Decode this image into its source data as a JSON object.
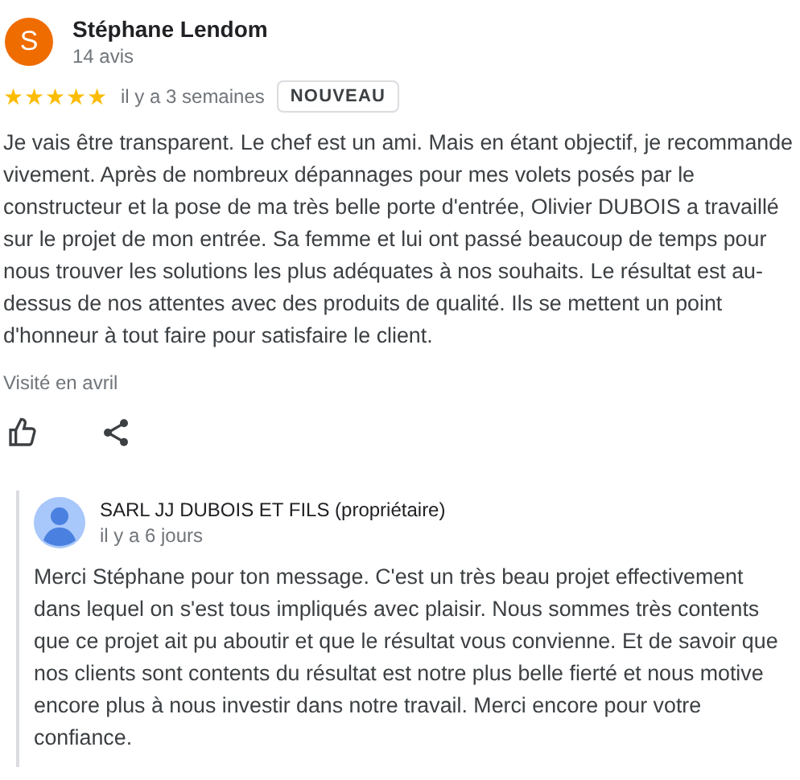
{
  "review": {
    "avatar_letter": "S",
    "author": "Stéphane Lendom",
    "author_meta": "14 avis",
    "stars": 5,
    "time": "il y a 3 semaines",
    "badge": "NOUVEAU",
    "text": "Je vais être transparent. Le chef est un ami. Mais en étant objectif, je recommande vivement. Après de nombreux dépannages pour mes volets posés par le constructeur et la pose de ma très belle porte d'entrée, Olivier DUBOIS a travaillé sur le projet de mon entrée. Sa femme et lui ont passé beaucoup de temps pour nous trouver les solutions les plus adéquates à nos souhaits. Le résultat est au-dessus de nos attentes avec des produits de qualité. Ils se mettent un point d'honneur à tout faire pour satisfaire le client.",
    "visit": "Visité en avril"
  },
  "reply": {
    "author": "SARL JJ DUBOIS ET FILS (propriétaire)",
    "time": "il y a 6 jours",
    "text": "Merci Stéphane pour ton message. C'est un très beau projet effectivement dans lequel on s'est tous impliqués avec plaisir. Nous sommes très contents que ce projet ait pu aboutir et que le résultat vous convienne. Et de savoir que nos clients sont contents du résultat est notre plus belle fierté et nous motive encore plus à nous investir dans notre travail. Merci encore pour votre confiance."
  }
}
